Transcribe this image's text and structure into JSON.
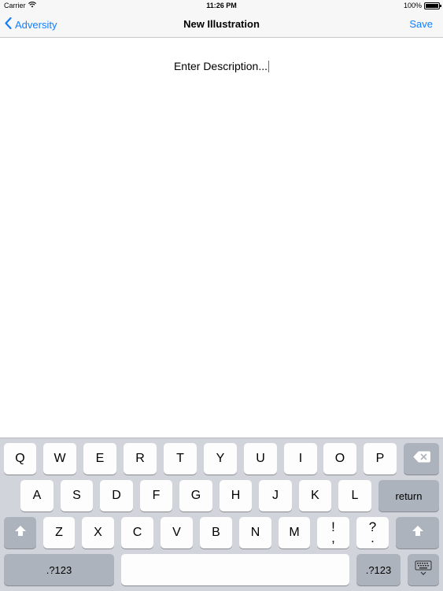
{
  "status_bar": {
    "carrier": "Carrier",
    "time": "11:26 PM",
    "battery": "100%"
  },
  "nav": {
    "back_label": "Adversity",
    "title": "New Illustration",
    "save_label": "Save"
  },
  "content": {
    "description_placeholder": "Enter Description..."
  },
  "keyboard": {
    "row1": [
      "Q",
      "W",
      "E",
      "R",
      "T",
      "Y",
      "U",
      "I",
      "O",
      "P"
    ],
    "row2": [
      "A",
      "S",
      "D",
      "F",
      "G",
      "H",
      "J",
      "K",
      "L"
    ],
    "row3": [
      "Z",
      "X",
      "C",
      "V",
      "B",
      "N",
      "M"
    ],
    "return_label": "return",
    "exclaim_top": "!",
    "exclaim_bottom": ",",
    "question_top": "?",
    "question_bottom": ".",
    "numbers_label": ".?123"
  },
  "colors": {
    "accent": "#147efb",
    "keyboard_bg": "#d1d5db",
    "key_light": "#fdfdfd",
    "key_dark": "#adb3bc"
  }
}
